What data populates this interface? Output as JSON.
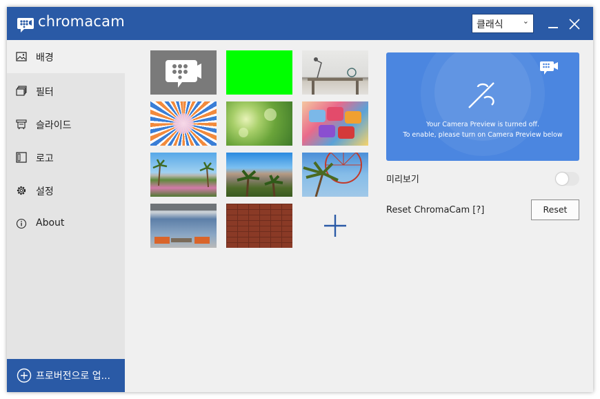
{
  "app": {
    "title": "chromacam"
  },
  "header": {
    "mode_select": {
      "value": "클래식"
    },
    "minimize_icon": "minimize-icon",
    "close_icon": "close-icon"
  },
  "sidebar": {
    "items": [
      {
        "label": "배경",
        "icon": "image-icon",
        "active": true
      },
      {
        "label": "필터",
        "icon": "filter-icon",
        "active": false
      },
      {
        "label": "슬라이드",
        "icon": "slide-icon",
        "active": false
      },
      {
        "label": "로고",
        "icon": "logo-icon",
        "active": false
      },
      {
        "label": "설정",
        "icon": "gear-icon",
        "active": false
      },
      {
        "label": "About",
        "icon": "info-icon",
        "active": false
      }
    ],
    "upgrade": {
      "label": "프로버전으로 업...",
      "icon": "plus-circle-icon"
    }
  },
  "backgrounds": {
    "tiles": [
      "chromacam-logo",
      "green-screen",
      "white-brick-desk",
      "orange-blue-sunburst",
      "green-bokeh",
      "colorful-speech-bubbles",
      "desert-park",
      "palm-trees-mountains",
      "ferris-wheel-palms",
      "modern-lounge",
      "red-brick-wall"
    ],
    "add_icon": "plus-icon"
  },
  "preview": {
    "line1": "Your Camera Preview is turned off.",
    "line2": "To enable, please turn on Camera Preview below",
    "label": "미리보기",
    "enabled": false
  },
  "reset": {
    "label": "Reset ChromaCam [?]",
    "button": "Reset"
  },
  "colors": {
    "accent": "#2a5aa6",
    "preview_bg": "#4b86e0",
    "green_screen": "#00ff00"
  }
}
